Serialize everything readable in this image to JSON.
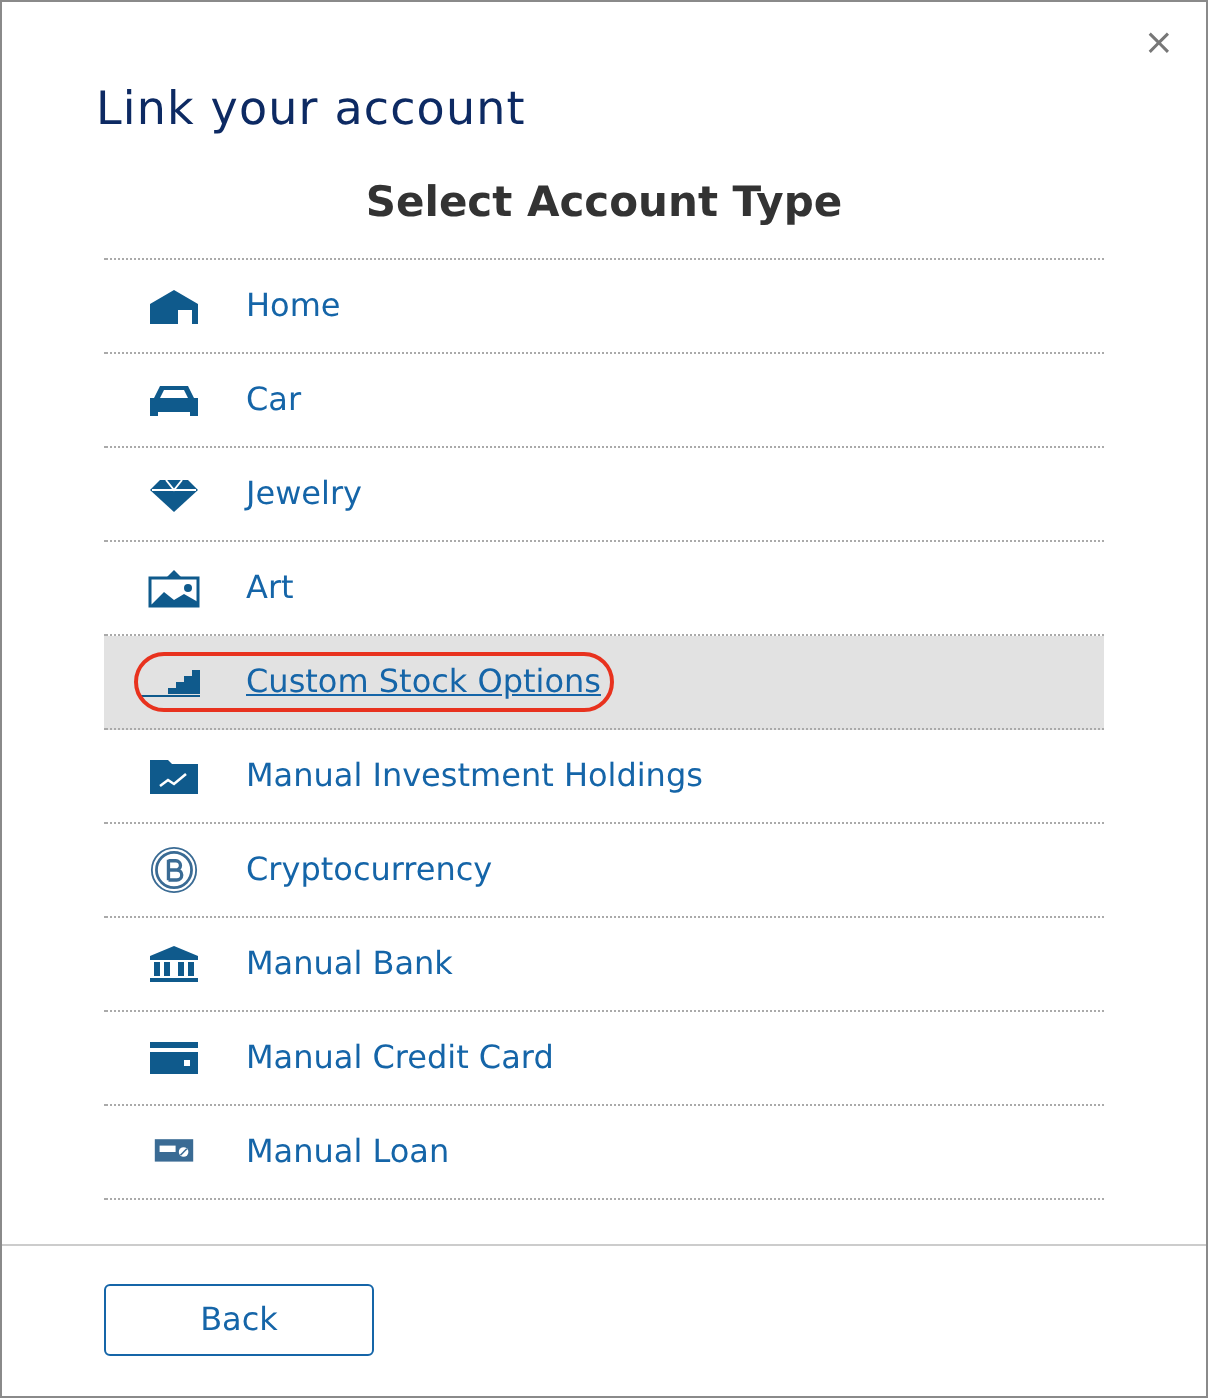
{
  "dialog": {
    "title": "Link your account",
    "subtitle": "Select Account Type"
  },
  "account_types": [
    {
      "label": "Home",
      "selected": false
    },
    {
      "label": "Car",
      "selected": false
    },
    {
      "label": "Jewelry",
      "selected": false
    },
    {
      "label": "Art",
      "selected": false
    },
    {
      "label": "Custom Stock Options",
      "selected": true
    },
    {
      "label": "Manual Investment Holdings",
      "selected": false
    },
    {
      "label": "Cryptocurrency",
      "selected": false
    },
    {
      "label": "Manual Bank",
      "selected": false
    },
    {
      "label": "Manual Credit Card",
      "selected": false
    },
    {
      "label": "Manual Loan",
      "selected": false
    }
  ],
  "close": "×",
  "buttons": [
    "Back"
  ]
}
